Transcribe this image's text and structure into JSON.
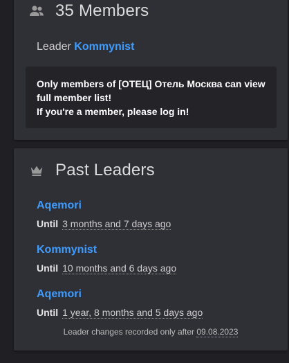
{
  "members": {
    "title": "35 Members",
    "icon": "group-icon",
    "leader_label": "Leader",
    "leader_name": "Kommynist",
    "notice_line1": "Only members of [ОТЕЦ] Отель Москва can view full member list!",
    "notice_line2": "If you're a member, please log in!"
  },
  "past_leaders": {
    "title": "Past Leaders",
    "icon": "crown-icon",
    "until_label": "Until",
    "entries": [
      {
        "name": "Aqemori",
        "until": "3 months and 7 days ago"
      },
      {
        "name": "Kommynist",
        "until": "10 months and 6 days ago"
      },
      {
        "name": "Aqemori",
        "until": "1 year, 8 months and 5 days ago"
      }
    ],
    "footnote_text": "Leader changes recorded only after",
    "footnote_date": "09.08.2023"
  },
  "colors": {
    "background": "#202024",
    "card": "#2f2f36",
    "link": "#3f9cff",
    "notice_bg": "#232328"
  }
}
